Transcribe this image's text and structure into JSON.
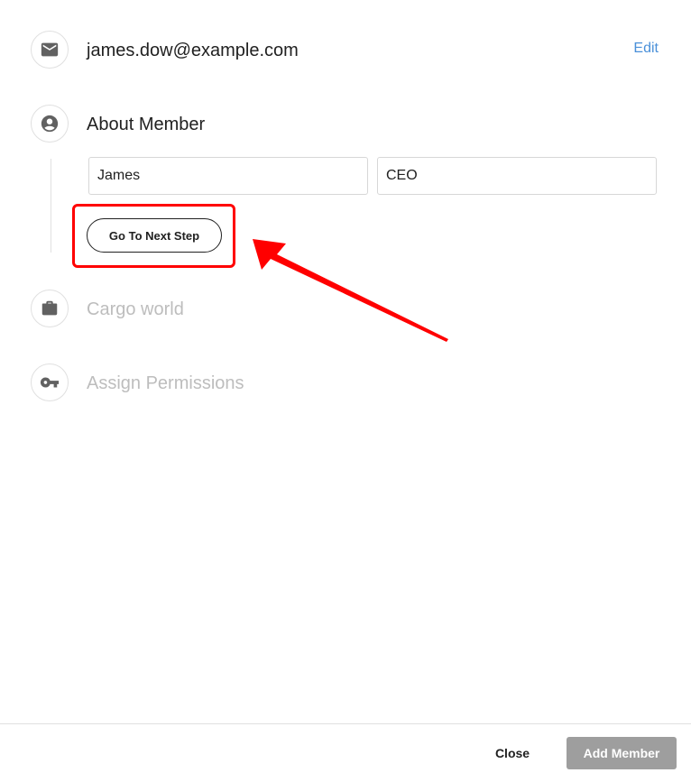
{
  "steps": {
    "email": {
      "value": "james.dow@example.com",
      "edit_label": "Edit",
      "icon": "mail-icon"
    },
    "about": {
      "title": "About Member",
      "icon": "account-circle-icon"
    },
    "cargo": {
      "title": "Cargo world",
      "icon": "briefcase-icon"
    },
    "permissions": {
      "title": "Assign Permissions",
      "icon": "key-icon"
    }
  },
  "form": {
    "first_name_value": "James",
    "job_title_value": "CEO",
    "next_button_label": "Go To Next Step"
  },
  "footer": {
    "close_label": "Close",
    "add_member_label": "Add Member"
  },
  "colors": {
    "annotation": "#ff0000",
    "link": "#4a90d9",
    "disabled_button": "#9e9e9e",
    "muted_text": "#bdbdbd"
  }
}
